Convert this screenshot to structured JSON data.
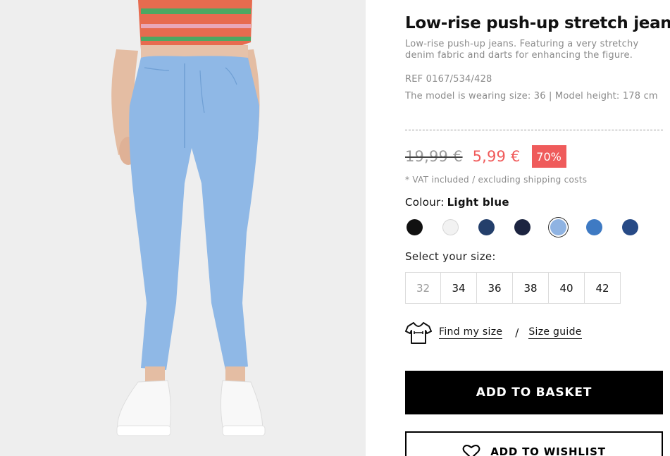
{
  "product": {
    "title": "Low-rise push-up stretch jeans",
    "description": "Low-rise push-up jeans. Featuring a very stretchy denim fabric and darts for enhancing the figure.",
    "ref": "REF 0167/534/428",
    "model_info": "The model is wearing size: 36 | Model height: 178 cm"
  },
  "pricing": {
    "old_price": "19,99 €",
    "new_price": "5,99 €",
    "discount": "70%",
    "vat_note": "* VAT included / excluding shipping costs"
  },
  "colour": {
    "label": "Colour:",
    "selected": "Light blue",
    "swatches": [
      {
        "name": "black",
        "hex": "#111111",
        "selected": false
      },
      {
        "name": "white",
        "hex": "#f2f2f2",
        "selected": false
      },
      {
        "name": "navy",
        "hex": "#243f6b",
        "selected": false
      },
      {
        "name": "dark-navy",
        "hex": "#1c2440",
        "selected": false
      },
      {
        "name": "light-blue",
        "hex": "#8fb3e2",
        "selected": true
      },
      {
        "name": "mid-blue",
        "hex": "#3e7ac3",
        "selected": false
      },
      {
        "name": "indigo",
        "hex": "#274a86",
        "selected": false
      }
    ]
  },
  "size": {
    "label": "Select your size:",
    "options": [
      {
        "label": "32",
        "available": false
      },
      {
        "label": "34",
        "available": true
      },
      {
        "label": "36",
        "available": true
      },
      {
        "label": "38",
        "available": true
      },
      {
        "label": "40",
        "available": true
      },
      {
        "label": "42",
        "available": true
      }
    ]
  },
  "links": {
    "find_my_size": "Find my size",
    "separator": "/",
    "size_guide": "Size guide"
  },
  "actions": {
    "add_to_basket": "ADD TO BASKET",
    "add_to_wishlist": "ADD TO WISHLIST"
  },
  "colors": {
    "sale_red": "#f05a5a",
    "badge_red": "#ef5b5b",
    "primary_black": "#000000",
    "muted_gray": "#8a8a8a"
  },
  "icons": {
    "tshirt": "tshirt-icon",
    "heart": "heart-icon"
  }
}
